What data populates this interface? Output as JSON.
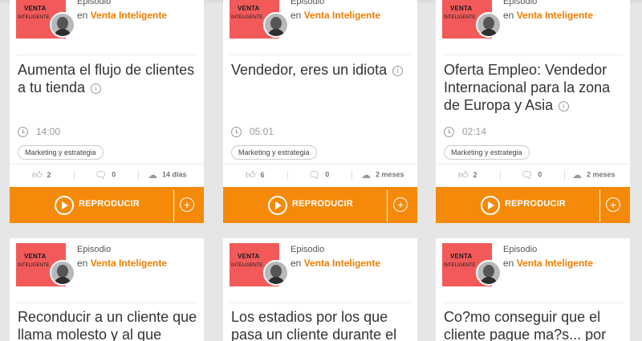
{
  "show": {
    "type_label": "Episodio",
    "prefix": "en",
    "name": "Venta Inteligente",
    "cover_title": "VENTA",
    "cover_sub": "INTELIGENTE"
  },
  "actions": {
    "play_label": "REPRODUCIR",
    "add_symbol": "+"
  },
  "icons": {
    "info": "info-circle-icon",
    "clock": "clock-icon",
    "like": "thumbs-up-icon",
    "comment": "comment-bubble-icon",
    "download": "cloud-download-icon",
    "play": "play-circle-icon",
    "add": "plus-circle-icon"
  },
  "colors": {
    "accent": "#f58a0a",
    "link": "#f07d00",
    "cover": "#f25a5a"
  },
  "cards_top": [
    {
      "title": "Aumenta el flujo de clientes a tu tienda",
      "duration": "14:00",
      "tag": "Marketing y estrategia",
      "likes": "2",
      "comments": "0",
      "age": "14 días"
    },
    {
      "title": "Vendedor, eres un idiota",
      "duration": "05:01",
      "tag": "Marketing y estrategia",
      "likes": "6",
      "comments": "0",
      "age": "2 meses"
    },
    {
      "title": "Oferta Empleo: Vendedor Internacional para la zona de Europa y Asia",
      "duration": "02:14",
      "tag": "Marketing y estrategia",
      "likes": "2",
      "comments": "0",
      "age": "2 meses"
    }
  ],
  "cards_bottom": [
    {
      "title": "Reconducir a un cliente que llama molesto y al que"
    },
    {
      "title": "Los estadios por los que pasa un cliente durante el"
    },
    {
      "title": "Co?mo conseguir que el cliente pague ma?s... por"
    }
  ]
}
